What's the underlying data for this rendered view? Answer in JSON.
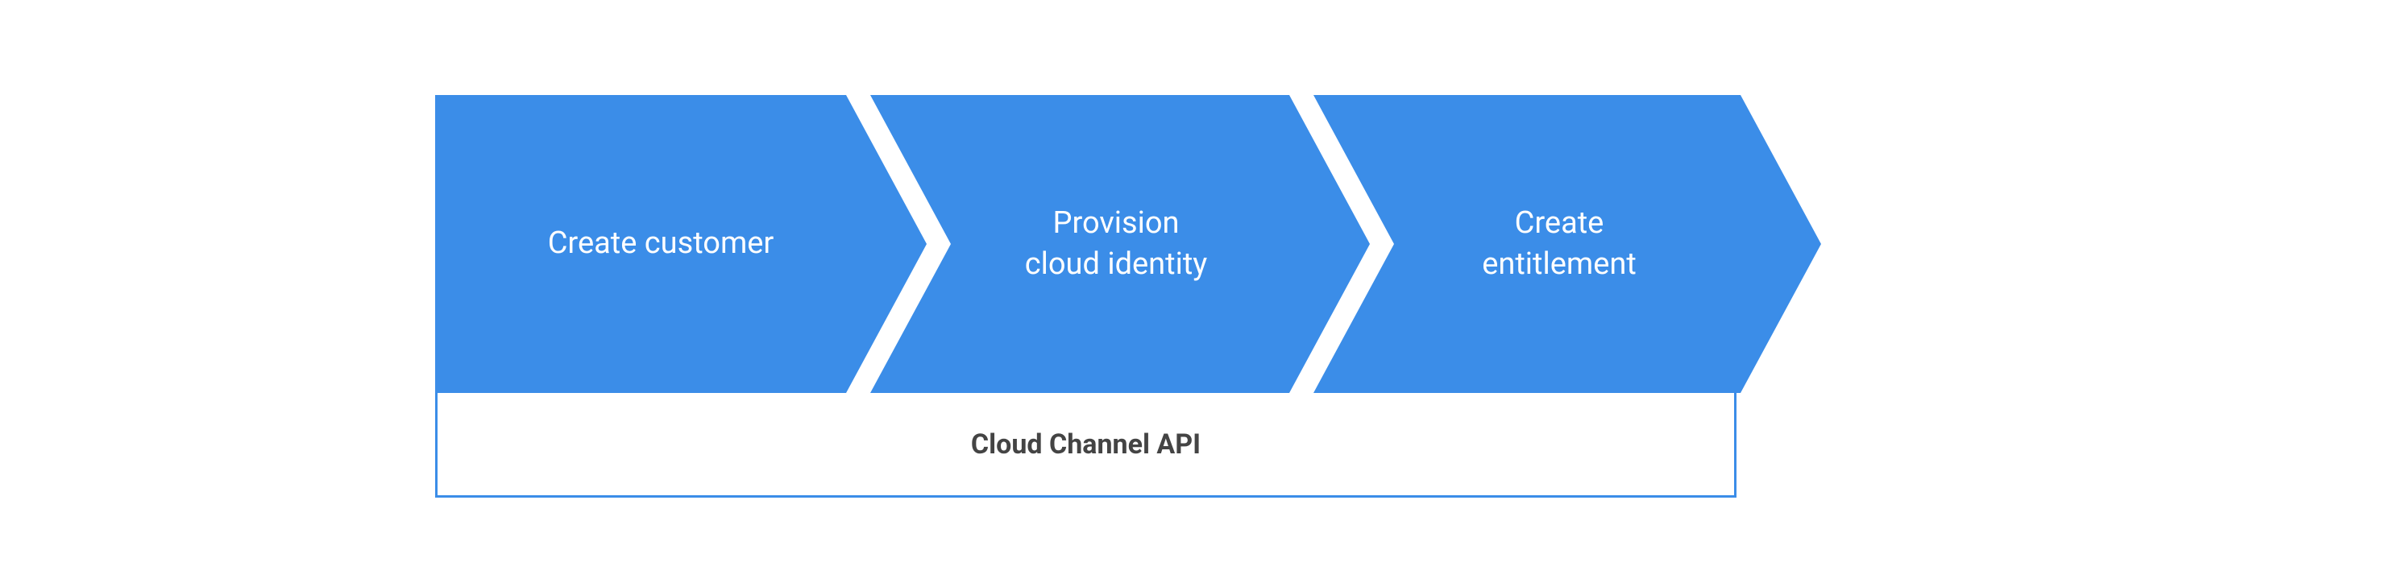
{
  "steps": [
    {
      "label": "Create customer"
    },
    {
      "label": "Provision\ncloud identity"
    },
    {
      "label": "Create\nentitlement"
    }
  ],
  "api_label": "Cloud Channel API",
  "colors": {
    "primary": "#3b8de8",
    "text": "#444444"
  }
}
